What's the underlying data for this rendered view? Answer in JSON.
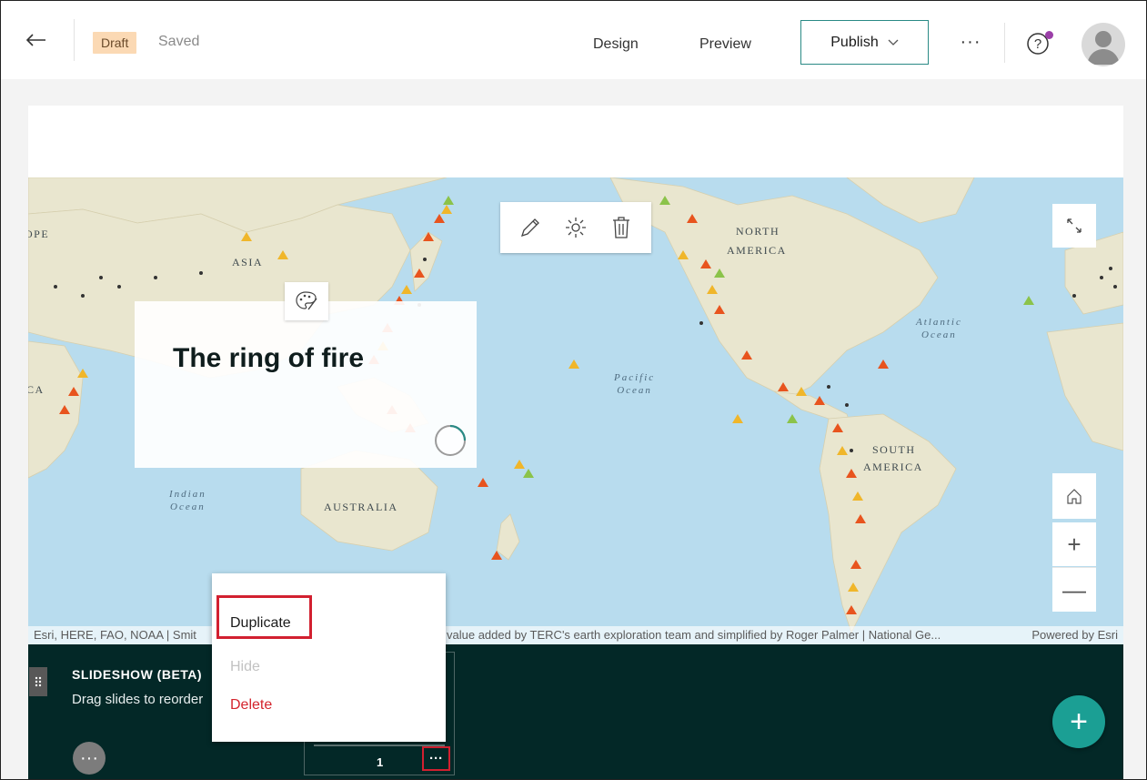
{
  "topbar": {
    "back_icon": "arrow-left-icon",
    "status_badge": "Draft",
    "saved_text": "Saved",
    "nav_design": "Design",
    "nav_preview": "Preview",
    "publish_label": "Publish",
    "more_label": "···",
    "help_icon": "help-icon",
    "notification_color": "#9b3fa8",
    "accent_color": "#2a8a85"
  },
  "map": {
    "labels": {
      "europe": "OPE",
      "asia": "ASIA",
      "north_america_1": "NORTH",
      "north_america_2": "AMERICA",
      "south_america_1": "SOUTH",
      "south_america_2": "AMERICA",
      "australia": "AUSTRALIA",
      "africa": "CA",
      "pacific_1": "Pacific",
      "pacific_2": "Ocean",
      "atlantic_1": "Atlantic",
      "atlantic_2": "Ocean",
      "indian_1": "Indian",
      "indian_2": "Ocean"
    },
    "attribution_left": "Esri, HERE, FAO, NOAA | Smit",
    "attribution_mid": "value added by TERC's earth exploration team and simplified by Roger Palmer | National Ge...",
    "attribution_right": "Powered by Esri"
  },
  "title_card": {
    "title": "The ring of fire"
  },
  "slideshow": {
    "title": "SLIDESHOW (BETA)",
    "subtitle": "Drag slides to reorder",
    "slide_number": "1",
    "more_label": "···",
    "add_label": "+",
    "panel_color": "#032827",
    "fab_color": "#1b9f94"
  },
  "context_menu": {
    "duplicate": "Duplicate",
    "hide": "Hide",
    "delete": "Delete"
  },
  "map_controls": {
    "zoom_in": "+",
    "zoom_out": "—"
  }
}
